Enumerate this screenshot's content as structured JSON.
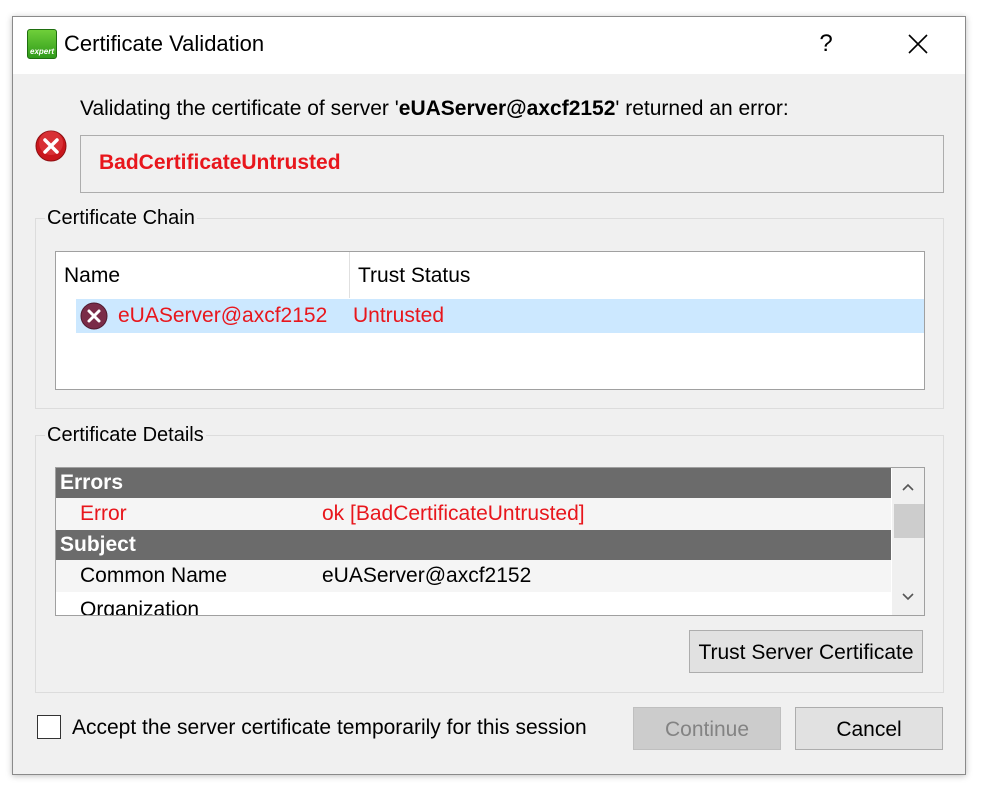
{
  "window": {
    "title": "Certificate Validation",
    "help_label": "?",
    "app_icon_text": "expert"
  },
  "message": {
    "prefix": "Validating the certificate of server '",
    "server": "eUAServer@axcf2152",
    "suffix": "' returned an error:",
    "error_code": "BadCertificateUntrusted"
  },
  "chain": {
    "title": "Certificate Chain",
    "columns": [
      "Name",
      "Trust Status"
    ],
    "rows": [
      {
        "name": "eUAServer@axcf2152",
        "status": "Untrusted",
        "icon": "error-icon",
        "selected": true
      }
    ]
  },
  "details": {
    "title": "Certificate Details",
    "sections": [
      {
        "header": "Errors",
        "rows": [
          {
            "key": "Error",
            "value": "ok [BadCertificateUntrusted]",
            "error": true
          }
        ]
      },
      {
        "header": "Subject",
        "rows": [
          {
            "key": "Common Name",
            "value": "eUAServer@axcf2152"
          },
          {
            "key": "Organization",
            "value": ""
          }
        ]
      }
    ],
    "trust_button": "Trust Server Certificate"
  },
  "footer": {
    "accept_label": "Accept the server certificate temporarily for this session",
    "accept_checked": false,
    "continue_label": "Continue",
    "cancel_label": "Cancel"
  },
  "colors": {
    "error_red": "#e8161c",
    "selection": "#cce8ff",
    "section_header": "#6b6b6b",
    "window_bg": "#f0f0f0"
  }
}
